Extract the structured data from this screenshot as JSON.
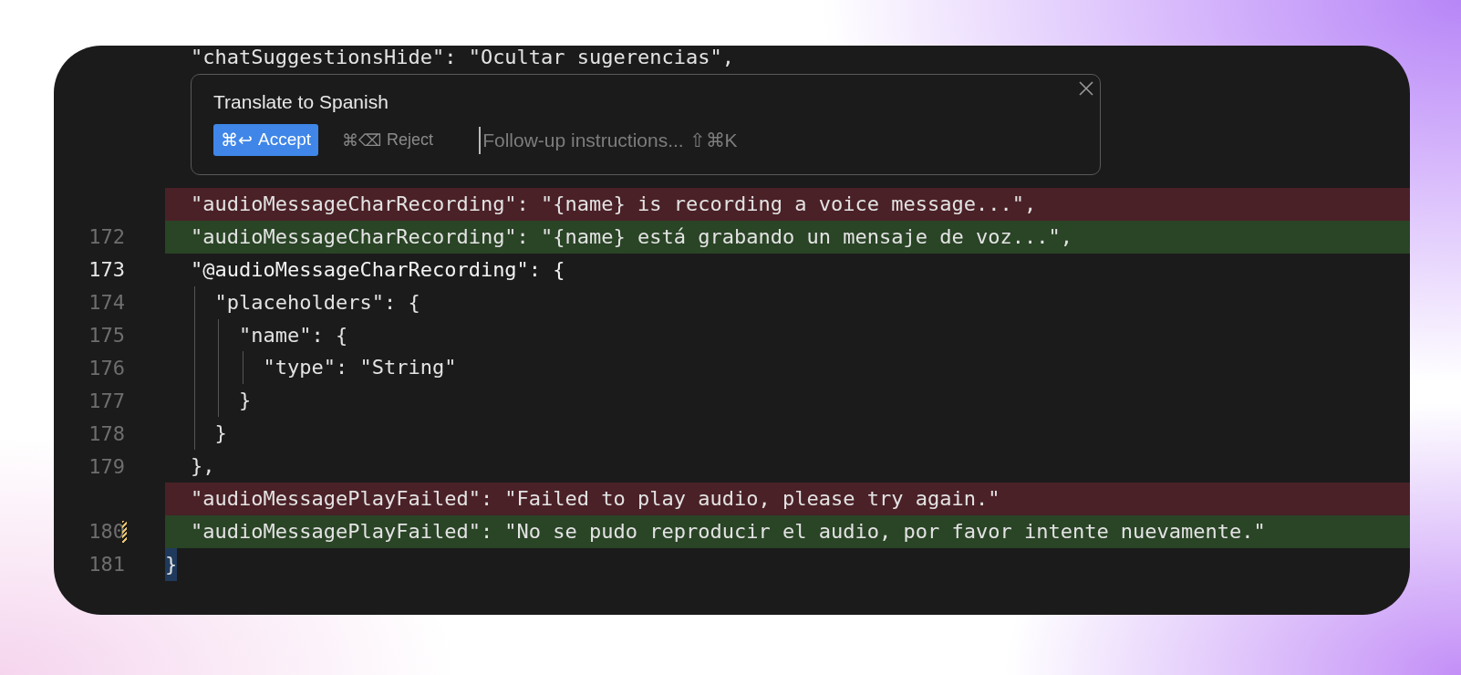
{
  "top_line": {
    "text": "\"chatSuggestionsHide\": \"Ocultar sugerencias\","
  },
  "prompt": {
    "title": "Translate to Spanish",
    "accept": {
      "keys": "⌘↩",
      "label": "Accept"
    },
    "reject": {
      "keys": "⌘⌫",
      "label": "Reject"
    },
    "input": {
      "placeholder": "Follow-up instructions... ⇧⌘K"
    }
  },
  "lines": [
    {
      "kind": "removed",
      "text": "\"audioMessageCharRecording\": \"{name} is recording a voice message...\",",
      "selected": false,
      "modified": false,
      "bracket_match": false
    },
    {
      "kind": "added",
      "number": "172",
      "text": "\"audioMessageCharRecording\": \"{name} está grabando un mensaje de voz...\",",
      "selected": false,
      "modified": false,
      "bracket_match": false
    },
    {
      "kind": "normal",
      "number": "173",
      "text": "\"@audioMessageCharRecording\": {",
      "selected": true,
      "modified": false,
      "bracket_match": false
    },
    {
      "kind": "normal",
      "number": "174",
      "text": "  \"placeholders\": {",
      "selected": false,
      "modified": false,
      "bracket_match": false
    },
    {
      "kind": "normal",
      "number": "175",
      "text": "    \"name\": {",
      "selected": false,
      "modified": false,
      "bracket_match": false
    },
    {
      "kind": "normal",
      "number": "176",
      "text": "      \"type\": \"String\"",
      "selected": false,
      "modified": false,
      "bracket_match": false
    },
    {
      "kind": "normal",
      "number": "177",
      "text": "    }",
      "selected": false,
      "modified": false,
      "bracket_match": false
    },
    {
      "kind": "normal",
      "number": "178",
      "text": "  }",
      "selected": false,
      "modified": false,
      "bracket_match": false
    },
    {
      "kind": "normal",
      "number": "179",
      "text": "},",
      "selected": false,
      "modified": false,
      "bracket_match": false
    },
    {
      "kind": "removed",
      "text": "\"audioMessagePlayFailed\": \"Failed to play audio, please try again.\"",
      "selected": false,
      "modified": false,
      "bracket_match": false
    },
    {
      "kind": "added",
      "number": "180",
      "text": "\"audioMessagePlayFailed\": \"No se pudo reproducir el audio, por favor intente nuevamente.\"",
      "selected": false,
      "modified": true,
      "bracket_match": false
    },
    {
      "kind": "closing",
      "number": "181",
      "text": "}",
      "selected": false,
      "modified": false,
      "bracket_match": true
    }
  ]
}
